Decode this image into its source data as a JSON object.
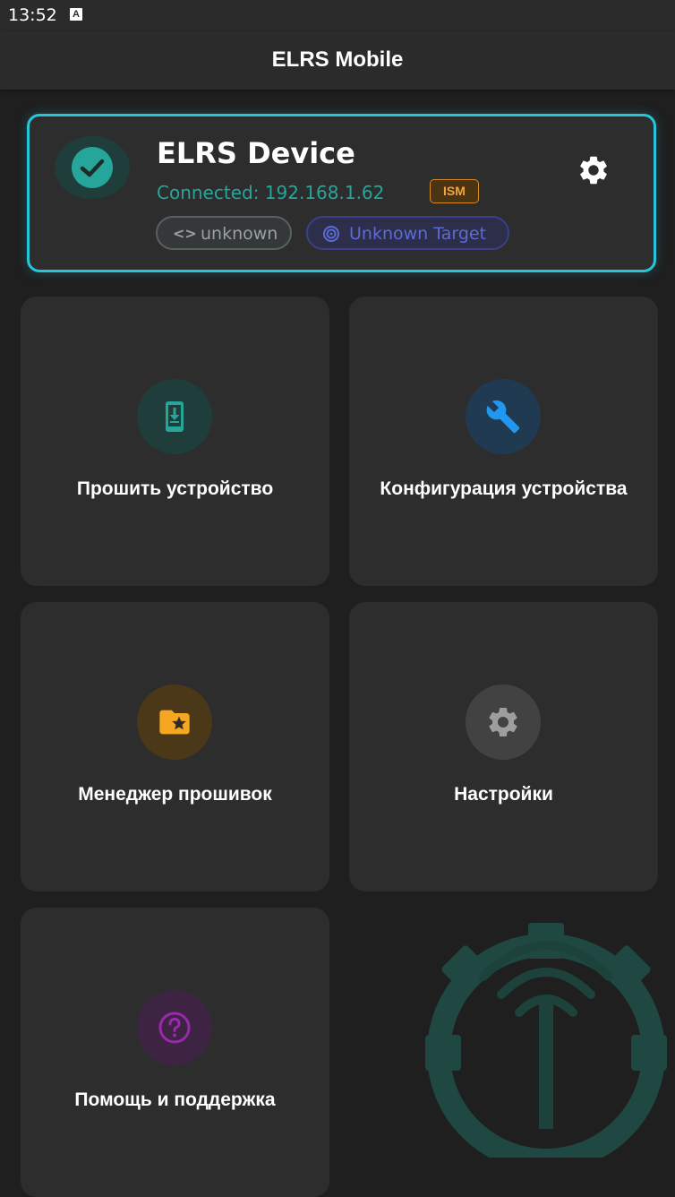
{
  "status_bar": {
    "time": "13:52",
    "notification_letter": "A"
  },
  "app_bar": {
    "title": "ELRS Mobile"
  },
  "device_card": {
    "name": "ELRS Device",
    "status": "Connected: 192.168.1.62",
    "badge": "ISM",
    "version_chip": "unknown",
    "target_chip": "Unknown Target",
    "icons": [
      "check-icon",
      "gear-icon",
      "code-icon",
      "radar-icon"
    ]
  },
  "tiles": [
    {
      "label": "Прошить устройство",
      "icon": "phone-download-icon",
      "color": "#26a69a"
    },
    {
      "label": "Конфигурация устройства",
      "icon": "wrench-icon",
      "color": "#2196f3"
    },
    {
      "label": "Менеджер прошивок",
      "icon": "folder-star-icon",
      "color": "#f5a623"
    },
    {
      "label": "Настройки",
      "icon": "gear-icon",
      "color": "#9e9e9e"
    },
    {
      "label": "Помощь и поддержка",
      "icon": "help-circle-icon",
      "color": "#9c27b0"
    }
  ],
  "colors": {
    "background": "#1f1f1f",
    "card": "#2d2d2d",
    "accent_cyan": "#26c6da",
    "connected_green": "#26a69a",
    "ism_orange": "#f3a53a",
    "target_blue": "#5c6bd6"
  }
}
